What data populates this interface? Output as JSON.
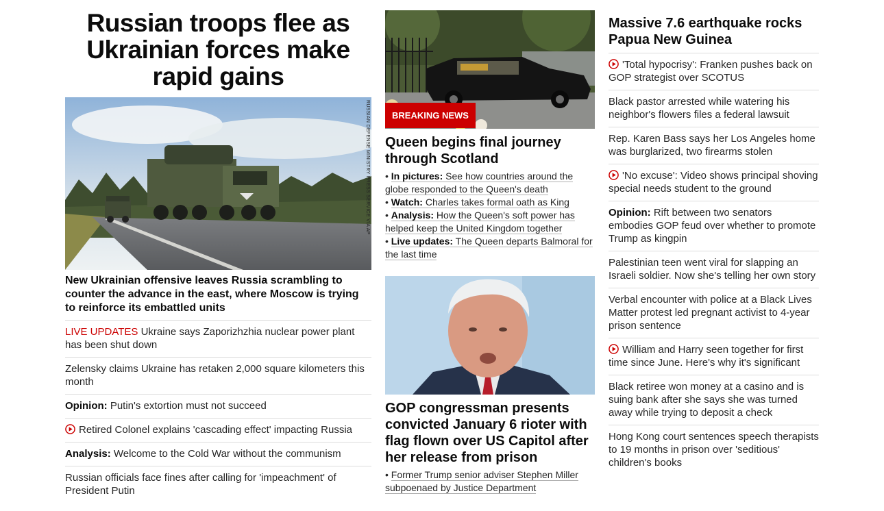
{
  "col1": {
    "headline": "Russian troops flee as Ukrainian forces make rapid gains",
    "image_credit": "RUSSIAN DEFENSE MINISTRY PRESS SERVICE VIA AP",
    "caption": "New Ukrainian offensive leaves Russia scrambling to counter the advance in the east, where Moscow is trying to reinforce its embattled units",
    "items": [
      {
        "prefix": "LIVE UPDATES",
        "text": " Ukraine says Zaporizhzhia nuclear power plant has been shut down"
      },
      {
        "prefix": "",
        "text": "Zelensky claims Ukraine has retaken 2,000 square kilometers this month"
      },
      {
        "prefix": "Opinion:",
        "text": " Putin's extortion must not succeed"
      },
      {
        "prefix": "",
        "text": "Retired Colonel explains 'cascading effect' impacting Russia"
      },
      {
        "prefix": "Analysis:",
        "text": " Welcome to the Cold War without the communism"
      },
      {
        "prefix": "",
        "text": "Russian officials face fines after calling for 'impeachment' of President Putin"
      }
    ]
  },
  "col2": {
    "breaking_label": "BREAKING NEWS",
    "queen_headline": "Queen begins final journey through Scotland",
    "bullets": [
      {
        "label": "In pictures:",
        "text": " See how countries around the globe responded to the Queen's death"
      },
      {
        "label": "Watch:",
        "text": " Charles takes formal oath as King"
      },
      {
        "label": "Analysis:",
        "text": " How the Queen's soft power has helped keep the United Kingdom together"
      },
      {
        "label": "Live updates:",
        "text": " The Queen departs Balmoral for the last time"
      }
    ],
    "gop_headline": "GOP congressman presents convicted January 6 rioter with flag flown over US Capitol after her release from prison",
    "gop_bullet": "Former Trump senior adviser Stephen Miller subpoenaed by Justice Department"
  },
  "col3": {
    "headline": "Massive 7.6 earthquake rocks Papua New Guinea",
    "items": [
      {
        "prefix": "",
        "text": "'Total hypocrisy': Franken pushes back on GOP strategist over SCOTUS"
      },
      {
        "prefix": "",
        "text": "Black pastor arrested while watering his neighbor's flowers files a federal lawsuit"
      },
      {
        "prefix": "",
        "text": "Rep. Karen Bass says her Los Angeles home was burglarized, two firearms stolen"
      },
      {
        "prefix": "",
        "text": "'No excuse': Video shows principal shoving special needs student to the ground"
      },
      {
        "prefix": "Opinion:",
        "text": " Rift between two senators embodies GOP feud over whether to promote Trump as kingpin"
      },
      {
        "prefix": "",
        "text": "Palestinian teen went viral for slapping an Israeli soldier. Now she's telling her own story"
      },
      {
        "prefix": "",
        "text": "Verbal encounter with police at a Black Lives Matter protest led pregnant activist to 4-year prison sentence"
      },
      {
        "prefix": "",
        "text": "William and Harry seen together for first time since June. Here's why it's significant"
      },
      {
        "prefix": "",
        "text": "Black retiree won money at a casino and is suing bank after she says she was turned away while trying to deposit a check"
      },
      {
        "prefix": "",
        "text": "Hong Kong court sentences speech therapists to 19 months in prison over 'seditious' children's books"
      }
    ]
  },
  "colors": {
    "accent": "#cc0000",
    "divider": "#dcdcdc",
    "text": "#0c0c0c"
  },
  "icons": {
    "video": "play-circle-icon"
  }
}
